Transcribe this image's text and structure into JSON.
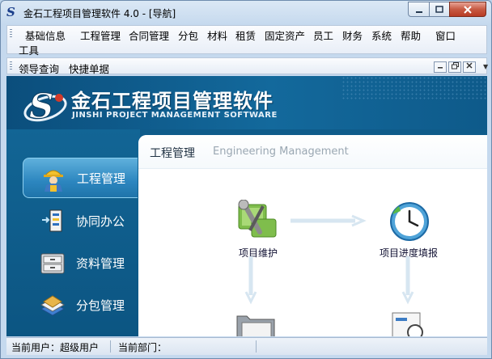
{
  "window": {
    "title": "金石工程项目管理软件 4.0 - [导航]",
    "logo_letter": "S"
  },
  "menubar": {
    "items": [
      "基础信息",
      "工程管理",
      "合同管理",
      "分包",
      "材料",
      "租赁",
      "固定资产",
      "员工",
      "财务",
      "系统",
      "帮助",
      "窗口"
    ],
    "overflow_item": "工具"
  },
  "quickbar": {
    "items": [
      "领导查询",
      "快捷单据"
    ]
  },
  "banner": {
    "title": "金石工程项目管理软件",
    "subtitle": "JINSHI PROJECT MANAGEMENT SOFTWARE"
  },
  "sidebar": {
    "items": [
      {
        "label": "工程管理",
        "icon": "worker-icon",
        "active": true
      },
      {
        "label": "协同办公",
        "icon": "office-icon",
        "active": false
      },
      {
        "label": "资料管理",
        "icon": "archive-icon",
        "active": false
      },
      {
        "label": "分包管理",
        "icon": "subcontract-icon",
        "active": false
      }
    ]
  },
  "content": {
    "title": "工程管理",
    "title_en": "Engineering Management",
    "functions": [
      {
        "label": "项目维护",
        "icon": "tools-icon"
      },
      {
        "label": "项目进度填报",
        "icon": "clock-icon"
      }
    ]
  },
  "statusbar": {
    "user_label": "当前用户：",
    "user_value": "超级用户",
    "dept_label": "当前部门："
  },
  "colors": {
    "banner_bg": "#13699c",
    "sidebar_active": "#2c86bf",
    "close_button": "#c75a43"
  }
}
